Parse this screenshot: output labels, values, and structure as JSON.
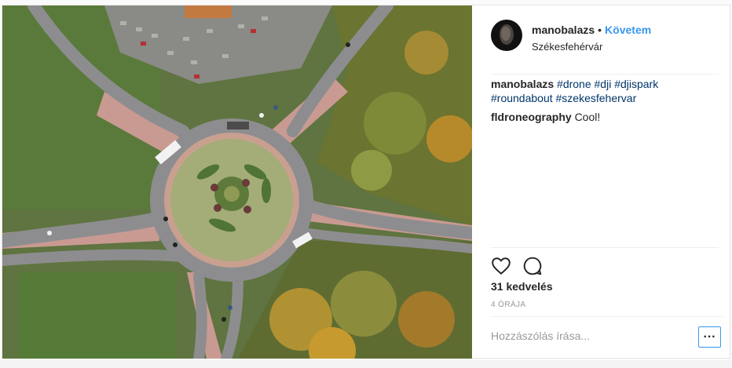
{
  "post": {
    "username": "manobalazs",
    "separator": "•",
    "follow_label": "Követem",
    "location": "Székesfehérvár",
    "caption": {
      "user": "manobalazs",
      "hashtags": "#drone #dji #djispark #roundabout #szekesfehervar"
    },
    "comments": [
      {
        "user": "fldroneography",
        "text": "Cool!"
      }
    ],
    "likes": "31 kedvelés",
    "time": "4 ÓRÁJA",
    "add_comment_placeholder": "Hozzászólás írása...",
    "more_label": "···",
    "icons": {
      "like": "heart-icon",
      "comment": "comment-bubble-icon",
      "more": "more-options-icon"
    },
    "colors": {
      "accent": "#3897f0",
      "text": "#262626",
      "muted": "#999999"
    }
  }
}
